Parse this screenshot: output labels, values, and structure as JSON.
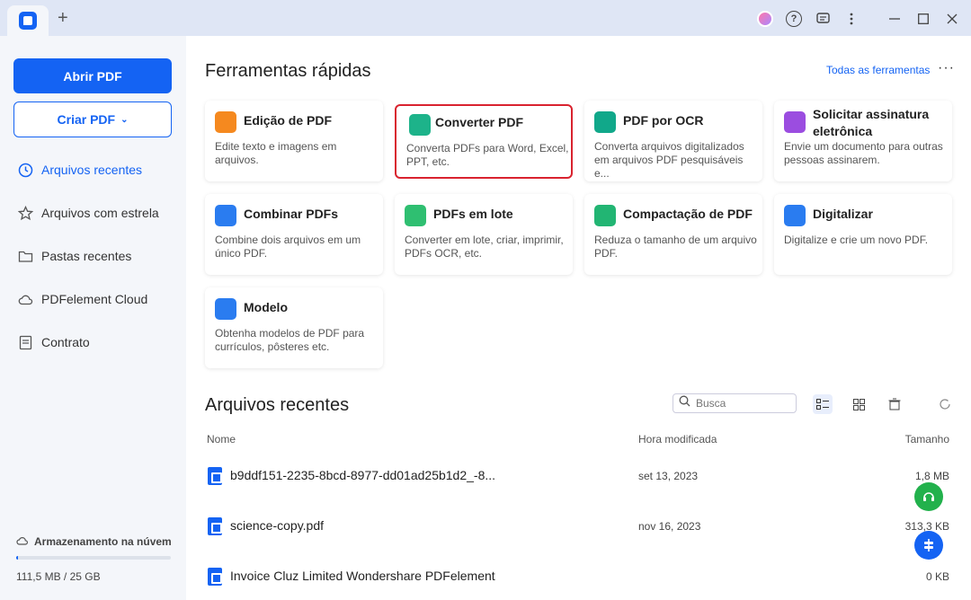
{
  "titlebar": {
    "icons": [
      "avatar-icon",
      "help-icon",
      "feedback-icon",
      "more-vertical-icon",
      "minimize-icon",
      "maximize-icon",
      "close-icon"
    ]
  },
  "sidebar": {
    "open_pdf": "Abrir PDF",
    "create_pdf": "Criar PDF",
    "items": [
      {
        "label": "Arquivos recentes",
        "icon": "clock-icon",
        "active": true
      },
      {
        "label": "Arquivos com estrela",
        "icon": "star-icon",
        "active": false
      },
      {
        "label": "Pastas recentes",
        "icon": "folder-icon",
        "active": false
      },
      {
        "label": "PDFelement Cloud",
        "icon": "cloud-icon",
        "active": false
      },
      {
        "label": "Contrato",
        "icon": "document-icon",
        "active": false
      }
    ],
    "storage": {
      "label": "Armazenamento na núvem",
      "value": "111,5 MB / 25 GB",
      "used_fraction": 0.0045
    }
  },
  "quick_tools": {
    "title": "Ferramentas rápidas",
    "all_tools_link": "Todas as ferramentas",
    "more": "···",
    "cards": [
      {
        "title": "Edição de PDF",
        "desc": "Edite texto e imagens em arquivos.",
        "icon": "edit-pdf-icon",
        "color": "#f5891f"
      },
      {
        "title": "Converter PDF",
        "desc": "Converta PDFs para Word, Excel, PPT, etc.",
        "icon": "convert-pdf-icon",
        "color": "#1db38a"
      },
      {
        "title": "PDF por OCR",
        "desc": "Converta arquivos digitalizados em arquivos PDF pesquisáveis e...",
        "icon": "ocr-icon",
        "color": "#11a88a"
      },
      {
        "title": "Solicitar assinatura eletrônica",
        "desc": "Envie um documento para outras pessoas assinarem.",
        "icon": "signature-icon",
        "color": "#9b4de0"
      },
      {
        "title": "Combinar PDFs",
        "desc": "Combine dois arquivos em um único PDF.",
        "icon": "combine-icon",
        "color": "#2a7cf0"
      },
      {
        "title": "PDFs em lote",
        "desc": "Converter em lote, criar, imprimir, PDFs OCR, etc.",
        "icon": "batch-icon",
        "color": "#2fbf71"
      },
      {
        "title": "Compactação de PDF",
        "desc": "Reduza o tamanho de um arquivo PDF.",
        "icon": "compress-icon",
        "color": "#22b573"
      },
      {
        "title": "Digitalizar",
        "desc": "Digitalize e crie um novo PDF.",
        "icon": "scanner-icon",
        "color": "#2a7cf0"
      },
      {
        "title": "Modelo",
        "desc": "Obtenha modelos de PDF para currículos, pôsteres etc.",
        "icon": "template-icon",
        "color": "#2a7cf0"
      }
    ]
  },
  "recent": {
    "title": "Arquivos recentes",
    "search_placeholder": "Busca",
    "columns": {
      "name": "Nome",
      "modified": "Hora modificada",
      "size": "Tamanho"
    },
    "files": [
      {
        "name": "b9ddf151-2235-8bcd-8977-dd01ad25b1d2_-8...",
        "modified": "set 13, 2023",
        "size": "1,8 MB"
      },
      {
        "name": "science-copy.pdf",
        "modified": "nov 16, 2023",
        "size": "313,3 KB"
      },
      {
        "name": "Invoice Cluz Limited Wondershare PDFelement",
        "modified": "",
        "size": "0 KB"
      }
    ]
  },
  "colors": {
    "accent": "#1463f3",
    "highlight_border": "#d9232f",
    "support_fab": "#22b14c"
  }
}
